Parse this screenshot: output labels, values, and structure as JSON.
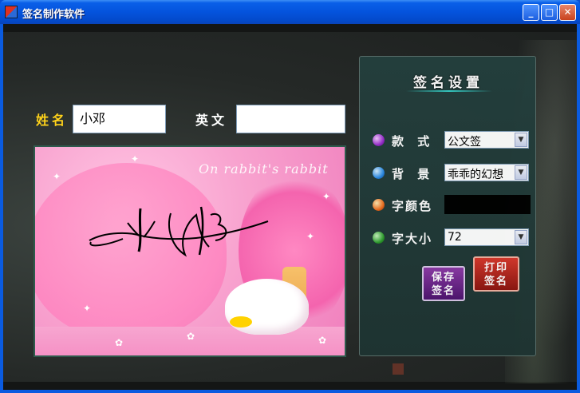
{
  "window": {
    "title": "签名制作软件",
    "buttons": {
      "minimize": "_",
      "maximize": "□",
      "close": "✕"
    }
  },
  "form": {
    "name_label": "姓名",
    "name_value": "小邓",
    "english_label": "英文",
    "english_value": ""
  },
  "preview": {
    "watermark": "On rabbit's rabbit"
  },
  "settings": {
    "title": "签名设置",
    "style_label": "款 式",
    "style_value": "公文签",
    "background_label": "背 景",
    "background_value": "乖乖的幻想",
    "color_label": "字颜色",
    "color_value": "#000000",
    "size_label": "字大小",
    "size_value": "72"
  },
  "actions": {
    "save_line1": "保存",
    "save_line2": "签名",
    "print_line1": "打印",
    "print_line2": "签名"
  },
  "icons": {
    "style_icon": "purple-orb-icon",
    "background_icon": "blue-orb-icon",
    "color_icon": "orange-orb-icon",
    "size_icon": "green-orb-icon"
  }
}
